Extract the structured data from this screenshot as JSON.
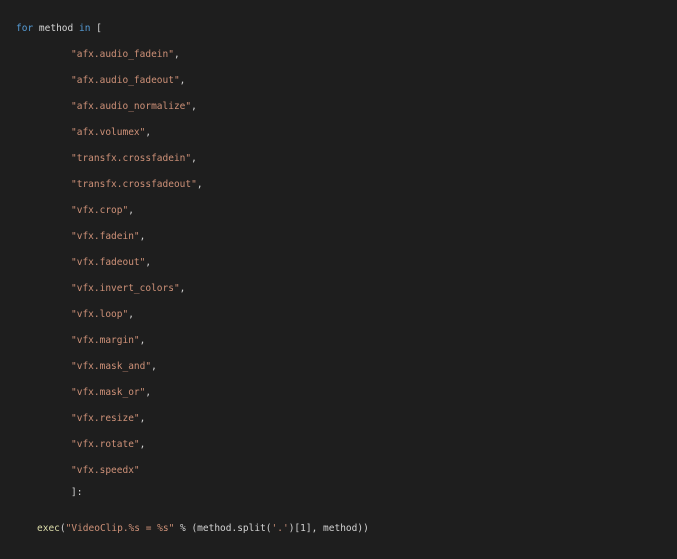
{
  "code": {
    "line1": {
      "kw_for": "for",
      "var": "method",
      "kw_in": "in",
      "bracket": "["
    },
    "items": [
      "\"afx.audio_fadein\"",
      "\"afx.audio_fadeout\"",
      "\"afx.audio_normalize\"",
      "\"afx.volumex\"",
      "\"transfx.crossfadein\"",
      "\"transfx.crossfadeout\"",
      "\"vfx.crop\"",
      "\"vfx.fadein\"",
      "\"vfx.fadeout\"",
      "\"vfx.invert_colors\"",
      "\"vfx.loop\"",
      "\"vfx.margin\"",
      "\"vfx.mask_and\"",
      "\"vfx.mask_or\"",
      "\"vfx.resize\"",
      "\"vfx.rotate\"",
      "\"vfx.speedx\""
    ],
    "comma": ",",
    "closing": "]:",
    "exec_line": {
      "fn": "exec",
      "open": "(",
      "fmt": "\"VideoClip.%s = %s\"",
      "mod": " % (method.split(",
      "dot_str": "'.'",
      "close1": ")[",
      "idx": "1",
      "rest": "], method))"
    },
    "colors": {
      "background": "#1e1e1e",
      "keyword": "#569cd6",
      "string": "#ce9178",
      "function": "#dcdcaa",
      "text": "#d4d4d4"
    }
  }
}
